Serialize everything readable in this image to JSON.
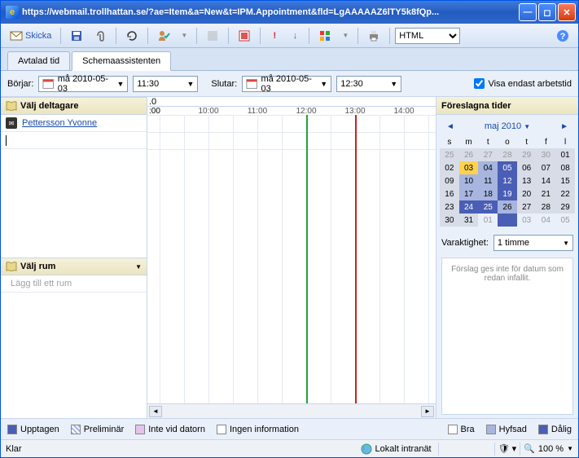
{
  "titlebar": {
    "url": "https://webmail.trollhattan.se/?ae=Item&a=New&t=IPM.Appointment&fld=LgAAAAAZ6lTY5k8fQp..."
  },
  "toolbar": {
    "send": "Skicka",
    "format_select": "HTML"
  },
  "tabs": {
    "appointment": "Avtalad tid",
    "scheduling": "Schemaassistenten"
  },
  "datebar": {
    "start_label": "Börjar:",
    "start_date": "må 2010-05-03",
    "start_time": "11:30",
    "end_label": "Slutar:",
    "end_date": "må 2010-05-03",
    "end_time": "12:30",
    "workhours_label": "Visa endast arbetstid"
  },
  "left": {
    "attendees_header": "Välj deltagare",
    "attendees": [
      "Pettersson Yvonne"
    ],
    "room_header": "Välj rum",
    "room_placeholder": "Lägg till ett rum"
  },
  "timeline": {
    "day": ".0",
    "firsthour": ":00",
    "hours": [
      "10:00",
      "11:00",
      "12:00",
      "13:00",
      "14:00"
    ]
  },
  "right": {
    "header": "Föreslagna tider",
    "month": "maj 2010",
    "weekdays": [
      "s",
      "m",
      "t",
      "o",
      "t",
      "f",
      "l"
    ],
    "calendar": [
      [
        {
          "d": "25",
          "c": "cg gray"
        },
        {
          "d": "26",
          "c": "cg gray"
        },
        {
          "d": "27",
          "c": "cg gray"
        },
        {
          "d": "28",
          "c": "cg gray"
        },
        {
          "d": "29",
          "c": "cg gray"
        },
        {
          "d": "30",
          "c": "cg gray"
        },
        {
          "d": "01",
          "c": "cg"
        }
      ],
      [
        {
          "d": "02",
          "c": "cg"
        },
        {
          "d": "03",
          "c": "ctoday"
        },
        {
          "d": "04",
          "c": "cb"
        },
        {
          "d": "05",
          "c": "cs"
        },
        {
          "d": "06",
          "c": "cg"
        },
        {
          "d": "07",
          "c": "cg"
        },
        {
          "d": "08",
          "c": "cg"
        }
      ],
      [
        {
          "d": "09",
          "c": "cg"
        },
        {
          "d": "10",
          "c": "cb"
        },
        {
          "d": "11",
          "c": "cb"
        },
        {
          "d": "12",
          "c": "cs"
        },
        {
          "d": "13",
          "c": "cg"
        },
        {
          "d": "14",
          "c": "cg"
        },
        {
          "d": "15",
          "c": "cg"
        }
      ],
      [
        {
          "d": "16",
          "c": "cg"
        },
        {
          "d": "17",
          "c": "cb"
        },
        {
          "d": "18",
          "c": "cb"
        },
        {
          "d": "19",
          "c": "cs"
        },
        {
          "d": "20",
          "c": "cg"
        },
        {
          "d": "21",
          "c": "cg"
        },
        {
          "d": "22",
          "c": "cg"
        }
      ],
      [
        {
          "d": "23",
          "c": "cg"
        },
        {
          "d": "24",
          "c": "cs"
        },
        {
          "d": "25",
          "c": "cs"
        },
        {
          "d": "26",
          "c": "cb"
        },
        {
          "d": "27",
          "c": "cg"
        },
        {
          "d": "28",
          "c": "cg"
        },
        {
          "d": "29",
          "c": "cg"
        }
      ],
      [
        {
          "d": "30",
          "c": "cg"
        },
        {
          "d": "31",
          "c": "cg"
        },
        {
          "d": "01",
          "c": "gray"
        },
        {
          "d": "",
          "c": "cs"
        },
        {
          "d": "03",
          "c": "gray"
        },
        {
          "d": "04",
          "c": "gray"
        },
        {
          "d": "05",
          "c": "gray"
        }
      ]
    ],
    "duration_label": "Varaktighet:",
    "duration_value": "1 timme",
    "suggestion": "Förslag ges inte för datum som redan infallit."
  },
  "legend": {
    "busy": "Upptagen",
    "tentative": "Preliminär",
    "away": "Inte vid datorn",
    "noinfo": "Ingen information",
    "good": "Bra",
    "ok": "Hyfsad",
    "bad": "Dålig"
  },
  "status": {
    "ready": "Klar",
    "zone": "Lokalt intranät",
    "zoom": "100 %"
  }
}
